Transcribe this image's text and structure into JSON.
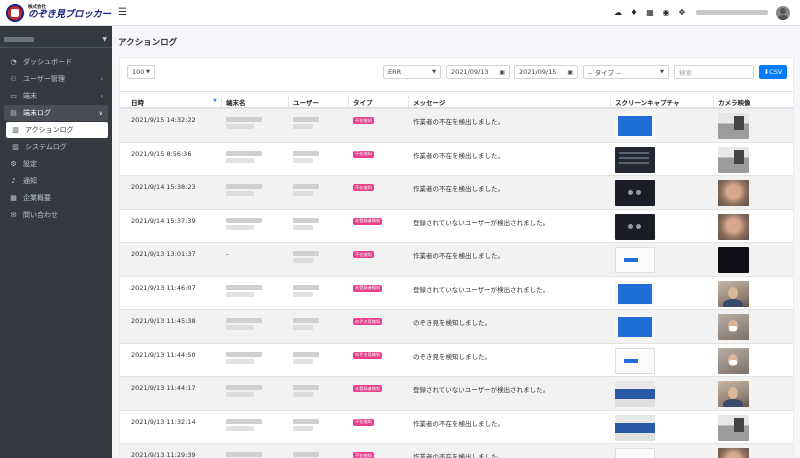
{
  "brand": {
    "small": "株式会社",
    "main": "のぞき見ブロッカー"
  },
  "sidebar": {
    "items": [
      {
        "label": "ダッシュボード",
        "icon": "dashboard-icon"
      },
      {
        "label": "ユーザー管理",
        "icon": "users-icon",
        "has_children": true
      },
      {
        "label": "端末",
        "icon": "laptop-icon",
        "has_children": true
      },
      {
        "label": "端末ログ",
        "icon": "log-icon",
        "open": true
      },
      {
        "label": "アクションログ",
        "icon": "clipboard-icon",
        "active": true
      },
      {
        "label": "システムログ",
        "icon": "clipboard-icon"
      },
      {
        "label": "設定",
        "icon": "settings-icon"
      },
      {
        "label": "通知",
        "icon": "bell-icon"
      },
      {
        "label": "企業概要",
        "icon": "building-icon"
      },
      {
        "label": "問い合わせ",
        "icon": "mail-icon"
      }
    ]
  },
  "topbar": {
    "icons": [
      "cloud-download-icon",
      "bell-icon",
      "grid-icon",
      "globe-icon",
      "expand-icon"
    ]
  },
  "page": {
    "title": "アクションログ"
  },
  "filters": {
    "page_size": "100",
    "level": "ERR",
    "date_from": "2021/09/13",
    "date_to": "2021/09/15",
    "type": "-- タイプ --",
    "search_placeholder": "検索",
    "csv_label": "CSV"
  },
  "table": {
    "headers": [
      "日時",
      "端末名",
      "ユーザー",
      "タイプ",
      "メッセージ",
      "スクリーンキャプチャ",
      "カメラ映像"
    ],
    "rows": [
      {
        "datetime": "2021/9/15 14:32:22",
        "terminal": "",
        "user": "",
        "type": "不在検知",
        "message": "作業者の不在を検出しました。",
        "screen": "blue",
        "camera": "room"
      },
      {
        "datetime": "2021/9/15 8:56:36",
        "terminal": "",
        "user": "",
        "type": "不在検知",
        "message": "作業者の不在を検出しました。",
        "screen": "dark",
        "camera": "room"
      },
      {
        "datetime": "2021/9/14 15:38:23",
        "terminal": "",
        "user": "",
        "type": "不在検知",
        "message": "作業者の不在を検出しました。",
        "screen": "dots",
        "camera": "blur"
      },
      {
        "datetime": "2021/9/14 15:37:39",
        "terminal": "",
        "user": "",
        "type": "未登録者検知",
        "message": "登録されていないユーザーが検出されました。",
        "screen": "dots",
        "camera": "blur"
      },
      {
        "datetime": "2021/9/13 13:01:37",
        "terminal": "-",
        "user": "",
        "type": "不在検知",
        "message": "作業者の不在を検出しました。",
        "screen": "white",
        "camera": "black"
      },
      {
        "datetime": "2021/9/13 11:46:07",
        "terminal": "",
        "user": "",
        "type": "未登録者検知",
        "message": "登録されていないユーザーが検出されました。",
        "screen": "blue",
        "camera": "face"
      },
      {
        "datetime": "2021/9/13 11:45:38",
        "terminal": "",
        "user": "",
        "type": "のぞき見検知",
        "message": "のぞき見を検知しました。",
        "screen": "blue",
        "camera": "mask"
      },
      {
        "datetime": "2021/9/13 11:44:50",
        "terminal": "",
        "user": "",
        "type": "のぞき見検知",
        "message": "のぞき見を検知しました。",
        "screen": "white",
        "camera": "mask"
      },
      {
        "datetime": "2021/9/13 11:44:17",
        "terminal": "",
        "user": "",
        "type": "未登録者検知",
        "message": "登録されていないユーザーが検出されました。",
        "screen": "mixed",
        "camera": "face"
      },
      {
        "datetime": "2021/9/13 11:32:14",
        "terminal": "",
        "user": "",
        "type": "不在検知",
        "message": "作業者の不在を検出しました。",
        "screen": "mixed",
        "camera": "room"
      },
      {
        "datetime": "2021/9/13 11:29:39",
        "terminal": "",
        "user": "",
        "type": "不在検知",
        "message": "作業者の不在を検出しました。",
        "screen": "white",
        "camera": "blur"
      }
    ]
  },
  "colors": {
    "sidebar_bg": "#343a40",
    "primary": "#007bff",
    "badge": "#e83e8c"
  }
}
